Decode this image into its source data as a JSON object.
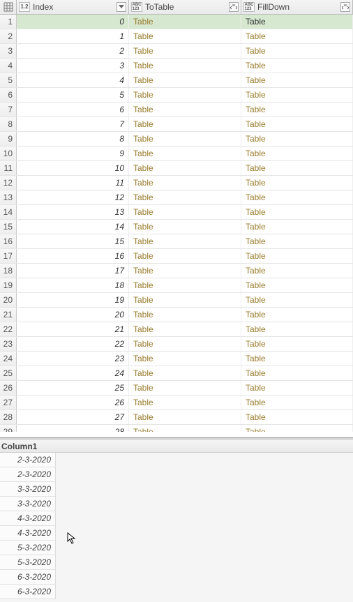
{
  "columns": {
    "index": {
      "label": "Index",
      "type": "1.2"
    },
    "totable": {
      "label": "ToTable",
      "type": "ABC\n123"
    },
    "filldown": {
      "label": "FillDown",
      "type": "ABC\n123"
    }
  },
  "rows": [
    {
      "n": "1",
      "index": "0",
      "totable": "Table",
      "filldown": "Table",
      "selected": true
    },
    {
      "n": "2",
      "index": "1",
      "totable": "Table",
      "filldown": "Table"
    },
    {
      "n": "3",
      "index": "2",
      "totable": "Table",
      "filldown": "Table"
    },
    {
      "n": "4",
      "index": "3",
      "totable": "Table",
      "filldown": "Table"
    },
    {
      "n": "5",
      "index": "4",
      "totable": "Table",
      "filldown": "Table"
    },
    {
      "n": "6",
      "index": "5",
      "totable": "Table",
      "filldown": "Table"
    },
    {
      "n": "7",
      "index": "6",
      "totable": "Table",
      "filldown": "Table"
    },
    {
      "n": "8",
      "index": "7",
      "totable": "Table",
      "filldown": "Table"
    },
    {
      "n": "9",
      "index": "8",
      "totable": "Table",
      "filldown": "Table"
    },
    {
      "n": "10",
      "index": "9",
      "totable": "Table",
      "filldown": "Table"
    },
    {
      "n": "11",
      "index": "10",
      "totable": "Table",
      "filldown": "Table"
    },
    {
      "n": "12",
      "index": "11",
      "totable": "Table",
      "filldown": "Table"
    },
    {
      "n": "13",
      "index": "12",
      "totable": "Table",
      "filldown": "Table"
    },
    {
      "n": "14",
      "index": "13",
      "totable": "Table",
      "filldown": "Table"
    },
    {
      "n": "15",
      "index": "14",
      "totable": "Table",
      "filldown": "Table"
    },
    {
      "n": "16",
      "index": "15",
      "totable": "Table",
      "filldown": "Table"
    },
    {
      "n": "17",
      "index": "16",
      "totable": "Table",
      "filldown": "Table"
    },
    {
      "n": "18",
      "index": "17",
      "totable": "Table",
      "filldown": "Table"
    },
    {
      "n": "19",
      "index": "18",
      "totable": "Table",
      "filldown": "Table"
    },
    {
      "n": "20",
      "index": "19",
      "totable": "Table",
      "filldown": "Table"
    },
    {
      "n": "21",
      "index": "20",
      "totable": "Table",
      "filldown": "Table"
    },
    {
      "n": "22",
      "index": "21",
      "totable": "Table",
      "filldown": "Table"
    },
    {
      "n": "23",
      "index": "22",
      "totable": "Table",
      "filldown": "Table"
    },
    {
      "n": "24",
      "index": "23",
      "totable": "Table",
      "filldown": "Table"
    },
    {
      "n": "25",
      "index": "24",
      "totable": "Table",
      "filldown": "Table"
    },
    {
      "n": "26",
      "index": "25",
      "totable": "Table",
      "filldown": "Table"
    },
    {
      "n": "27",
      "index": "26",
      "totable": "Table",
      "filldown": "Table"
    },
    {
      "n": "28",
      "index": "27",
      "totable": "Table",
      "filldown": "Table"
    }
  ],
  "partial_row": {
    "n": "29",
    "index": "28",
    "totable": "Table",
    "filldown": "Table"
  },
  "preview": {
    "header": "Column1",
    "values": [
      "2-3-2020",
      "2-3-2020",
      "3-3-2020",
      "3-3-2020",
      "4-3-2020",
      "4-3-2020",
      "5-3-2020",
      "5-3-2020",
      "6-3-2020",
      "6-3-2020"
    ]
  }
}
